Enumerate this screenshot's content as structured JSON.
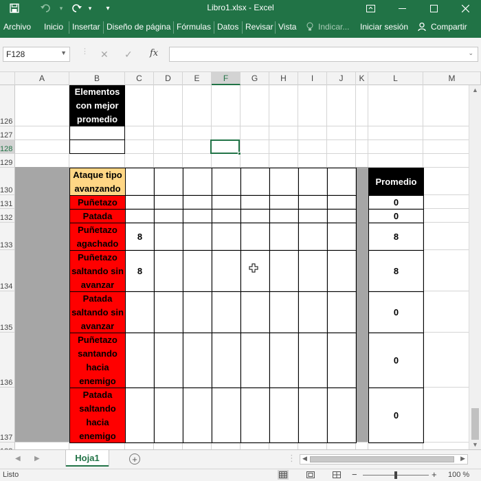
{
  "window": {
    "title": "Libro1.xlsx - Excel",
    "qa_save_icon": "save-icon",
    "qa_undo_icon": "undo-icon",
    "qa_redo_icon": "redo-icon",
    "qa_more_icon": "customize-icon"
  },
  "ribbon": {
    "tabs": [
      "Archivo",
      "Inicio",
      "Insertar",
      "Diseño de página",
      "Fórmulas",
      "Datos",
      "Revisar",
      "Vista"
    ],
    "tell_me": "Indicar...",
    "sign_in": "Iniciar sesión",
    "share": "Compartir"
  },
  "formula_bar": {
    "name_box": "F128",
    "fx": "fx",
    "content": ""
  },
  "columns": [
    "A",
    "B",
    "C",
    "D",
    "E",
    "F",
    "G",
    "H",
    "I",
    "J",
    "K",
    "L",
    "M"
  ],
  "selected_column": "F",
  "rows": [
    "126",
    "127",
    "128",
    "129",
    "130",
    "131",
    "132",
    "133",
    "134",
    "135",
    "136",
    "137",
    "138"
  ],
  "selected_row": "128",
  "table1": {
    "header": "Elementos con mejor promedio"
  },
  "table2": {
    "header": "Ataque tipo avanzando",
    "promedio_header": "Promedio",
    "items": [
      {
        "label": "Puñetazo",
        "c": "",
        "promedio": "0"
      },
      {
        "label": "Patada",
        "c": "",
        "promedio": "0"
      },
      {
        "label": "Puñetazo agachado",
        "c": "8",
        "promedio": "8"
      },
      {
        "label": "Puñetazo saltando sin avanzar",
        "c": "8",
        "promedio": "8"
      },
      {
        "label": "Patada saltando sin avanzar",
        "c": "",
        "promedio": "0"
      },
      {
        "label": "Puñetazo santando hacia enemigo",
        "c": "",
        "promedio": "0"
      },
      {
        "label": "Patada saltando hacia enemigo",
        "c": "",
        "promedio": "0"
      }
    ]
  },
  "sheets": {
    "active": "Hoja1"
  },
  "status": {
    "text": "Listo",
    "zoom": "100 %",
    "zoom_fraction": 0.5
  },
  "colors": {
    "excel_green": "#217346",
    "red_fill": "#ff0000",
    "header_black": "#000000",
    "tan_fill": "#ffd685",
    "gray_fill": "#a6a6a6"
  }
}
